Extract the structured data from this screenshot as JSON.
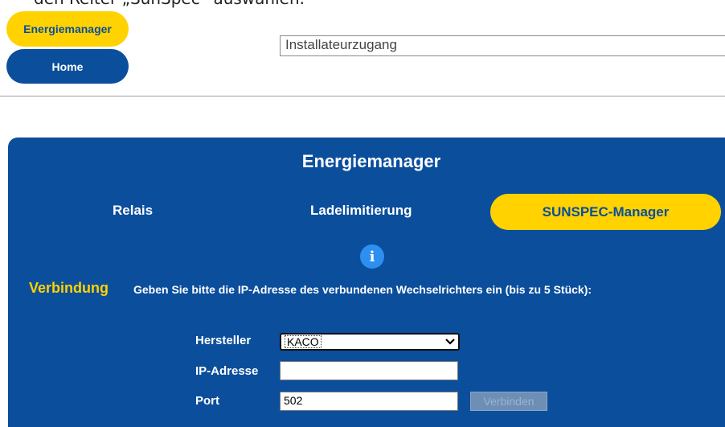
{
  "caption": "den Reiter „SunSpec“ auswählen.",
  "nav": {
    "energiemanager_label": "Energiemanager",
    "home_label": "Home"
  },
  "installer_field": {
    "value": "Installateurzugang"
  },
  "panel": {
    "title": "Energiemanager",
    "tabs": [
      {
        "label": "Relais",
        "active": false
      },
      {
        "label": "Ladelimitierung",
        "active": false
      },
      {
        "label": "SUNSPEC-Manager",
        "active": true
      }
    ],
    "info_icon": "info-icon"
  },
  "connection": {
    "section_label": "Verbindung",
    "instruction": "Geben Sie bitte die IP-Adresse des verbundenen Wechselrichters ein (bis zu 5 Stück):",
    "manufacturer_label": "Hersteller",
    "manufacturer_value": "KACO",
    "ip_label": "IP-Adresse",
    "ip_value": "",
    "port_label": "Port",
    "port_value": "502",
    "connect_label": "Verbinden"
  },
  "colors": {
    "panel_blue": "#0b4e9c",
    "accent_yellow": "#ffd200",
    "info_blue": "#2d8ff0"
  }
}
